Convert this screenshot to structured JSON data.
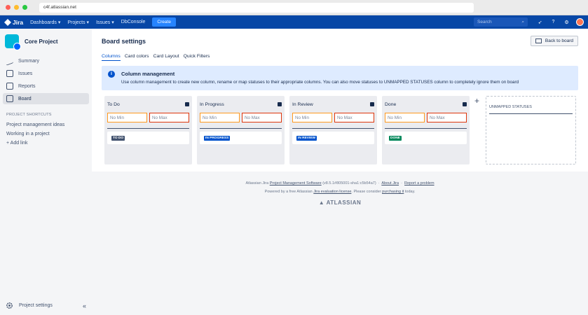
{
  "browser": {
    "url": "c4f.atlassian.net"
  },
  "topnav": {
    "logo": "Jira",
    "items": [
      "Dashboards ▾",
      "Projects ▾",
      "Issues ▾",
      "DbConsole"
    ],
    "create": "Create",
    "search_placeholder": "Search"
  },
  "sidebar": {
    "project_name": "Core Project",
    "items": [
      {
        "label": "Summary",
        "icon": "summary-icon"
      },
      {
        "label": "Issues",
        "icon": "issues-icon"
      },
      {
        "label": "Reports",
        "icon": "reports-icon"
      },
      {
        "label": "Board",
        "icon": "board-icon",
        "active": true
      }
    ],
    "shortcuts_heading": "PROJECT SHORTCUTS",
    "shortcuts": [
      "Project management ideas",
      "Working in a project",
      "+  Add link"
    ],
    "bottom_label": "Project settings",
    "collapse": "«"
  },
  "page": {
    "title": "Board settings",
    "back_button": "Back to board",
    "tabs": [
      "Columns",
      "Card colors",
      "Card Layout",
      "Quick Filters"
    ],
    "info_title": "Column management",
    "info_text": "Use column management to create new column, rename or map statuses to their appropriate columns. You can also move statuses to UNMAPPED STATUSES column to completely ignore them on board",
    "min_placeholder": "No Min",
    "max_placeholder": "No Max",
    "columns": [
      {
        "name": "To Do",
        "status": "TO DO",
        "status_color": "#42526e"
      },
      {
        "name": "In Progress",
        "status": "IN PROGRESS",
        "status_color": "#0052cc"
      },
      {
        "name": "In Review",
        "status": "IN REVIEW",
        "status_color": "#0052cc"
      },
      {
        "name": "Done",
        "status": "DONE",
        "status_color": "#00875a"
      }
    ],
    "unmapped_heading": "UNMAPPED STATUSES"
  },
  "footer": {
    "line1_prefix": "Atlassian Jira",
    "line1_link": "Project Management Software",
    "line1_version": "(v8.5.1#805001-sha1:c5b54a7)",
    "about": "About Jira",
    "report": "Report a problem",
    "line2_prefix": "Powered by a free Atlassian",
    "line2_link": "Jira evaluation license",
    "line2_mid": ". Please consider",
    "line2_link2": "purchasing it",
    "line2_suffix": "today.",
    "brand": "ATLASSIAN"
  }
}
